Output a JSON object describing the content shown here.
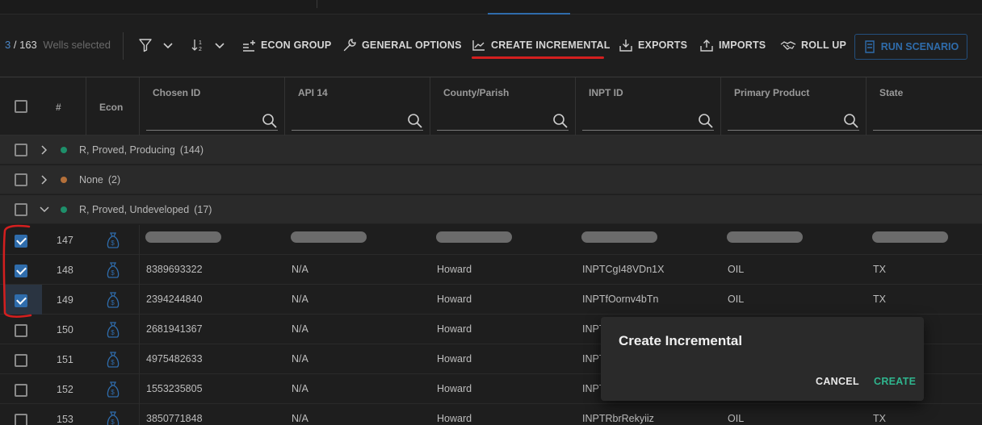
{
  "selection": {
    "count": "3",
    "total": "/ 163",
    "label": "Wells selected"
  },
  "toolbar": {
    "econ_group": "ECON GROUP",
    "general_options": "GENERAL OPTIONS",
    "create_incremental": "CREATE INCREMENTAL",
    "exports": "EXPORTS",
    "imports": "IMPORTS",
    "roll_up": "ROLL UP",
    "run_scenario": "RUN SCENARIO",
    "icons": [
      "filter-icon",
      "sort-icon",
      "econ-group-icon",
      "wrench-icon",
      "chart-icon",
      "export-icon",
      "import-icon",
      "handshake-icon",
      "run-icon"
    ]
  },
  "columns": {
    "num": "#",
    "econ": "Econ",
    "headers": [
      "Chosen ID",
      "API 14",
      "County/Parish",
      "INPT ID",
      "Primary Product",
      "State"
    ]
  },
  "groups": [
    {
      "label": "R, Proved, Producing",
      "count": "(144)",
      "color": "#1e8f6a"
    },
    {
      "label": "None",
      "count": "(2)",
      "color": "#b4703a"
    },
    {
      "label": "R, Proved, Undeveloped",
      "count": "(17)",
      "color": "#1e8f6a"
    }
  ],
  "rows": [
    {
      "num": "147",
      "checked": true,
      "chosen_id": "",
      "api14": "",
      "county": "",
      "inpt": "",
      "product": "",
      "state": "",
      "loading": true
    },
    {
      "num": "148",
      "checked": true,
      "chosen_id": "8389693322",
      "api14": "N/A",
      "county": "Howard",
      "inpt": "INPTCgI48VDn1X",
      "product": "OIL",
      "state": "TX"
    },
    {
      "num": "149",
      "checked": true,
      "chosen_id": "2394244840",
      "api14": "N/A",
      "county": "Howard",
      "inpt": "INPTfOornv4bTn",
      "product": "OIL",
      "state": "TX"
    },
    {
      "num": "150",
      "checked": false,
      "chosen_id": "2681941367",
      "api14": "N/A",
      "county": "Howard",
      "inpt": "INPT",
      "product": "",
      "state": ""
    },
    {
      "num": "151",
      "checked": false,
      "chosen_id": "4975482633",
      "api14": "N/A",
      "county": "Howard",
      "inpt": "INPT",
      "product": "",
      "state": ""
    },
    {
      "num": "152",
      "checked": false,
      "chosen_id": "1553235805",
      "api14": "N/A",
      "county": "Howard",
      "inpt": "INPT",
      "product": "",
      "state": ""
    },
    {
      "num": "153",
      "checked": false,
      "chosen_id": "3850771848",
      "api14": "N/A",
      "county": "Howard",
      "inpt": "INPTRbrRekyiiz",
      "product": "OIL",
      "state": "TX"
    }
  ],
  "dialog": {
    "title": "Create Incremental",
    "cancel": "CANCEL",
    "create": "CREATE"
  },
  "colors": {
    "accent": "#2f6cab",
    "create": "#2fb58e",
    "annotation": "#d41f1f"
  }
}
